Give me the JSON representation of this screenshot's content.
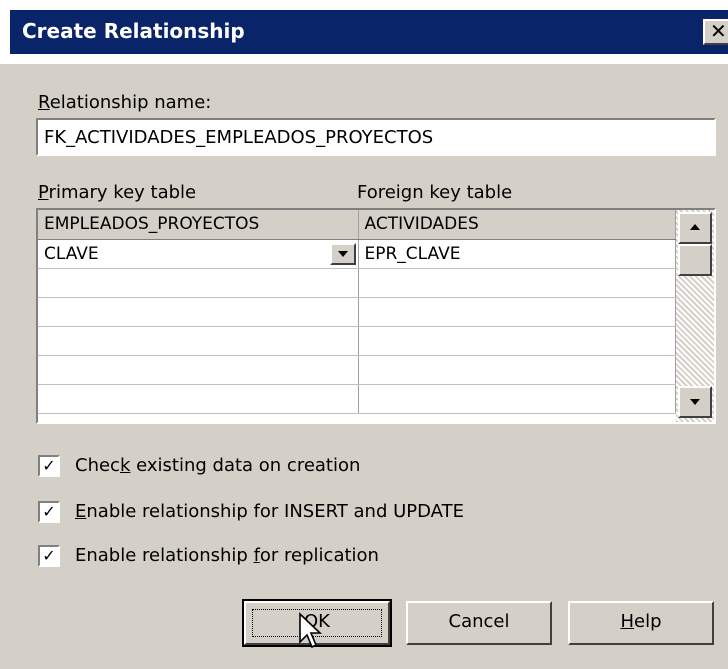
{
  "dialog": {
    "title": "Create Relationship",
    "close_glyph": "✕"
  },
  "relationship_name": {
    "label_prefix": "",
    "label_accel": "R",
    "label_rest": "elationship name:",
    "value": "FK_ACTIVIDADES_EMPLEADOS_PROYECTOS"
  },
  "primary_table_label": {
    "accel": "P",
    "rest": "rimary key table"
  },
  "foreign_table_label": "Foreign key table",
  "grid": {
    "primary_table": "EMPLEADOS_PROYECTOS",
    "foreign_table": "ACTIVIDADES",
    "rows": [
      {
        "primary": "CLAVE",
        "foreign": "EPR_CLAVE"
      },
      {
        "primary": "",
        "foreign": ""
      },
      {
        "primary": "",
        "foreign": ""
      },
      {
        "primary": "",
        "foreign": ""
      },
      {
        "primary": "",
        "foreign": ""
      },
      {
        "primary": "",
        "foreign": ""
      }
    ]
  },
  "options": {
    "check_existing": {
      "checked": true,
      "prefix": "Chec",
      "accel": "k",
      "rest": " existing data on creation"
    },
    "enable_insert_update": {
      "checked": true,
      "prefix": "",
      "accel": "E",
      "rest": "nable relationship for INSERT and UPDATE"
    },
    "enable_replication": {
      "checked": true,
      "prefix": "Enable relationship ",
      "accel": "f",
      "rest": "or replication"
    }
  },
  "buttons": {
    "ok": "OK",
    "cancel": "Cancel",
    "help_accel": "H",
    "help_rest": "elp"
  },
  "colors": {
    "title_bar": "#0a246a",
    "face": "#d4d0c8"
  },
  "icons": {
    "close": "close-icon",
    "dropdown": "chevron-down-icon",
    "scroll_up": "arrow-up-icon",
    "scroll_down": "arrow-down-icon",
    "checkbox": "checkmark-icon",
    "cursor": "mouse-pointer-icon"
  }
}
